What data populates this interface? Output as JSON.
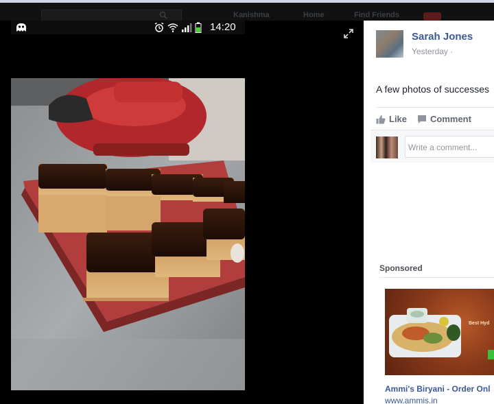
{
  "topbar": {
    "items": [
      "Kanishma",
      "Home",
      "Find Friends"
    ]
  },
  "status_bar": {
    "time": "14:20"
  },
  "post": {
    "author": "Sarah Jones",
    "timestamp": "Yesterday ·",
    "caption": "A few photos of successes",
    "actions": {
      "like_label": "Like",
      "comment_label": "Comment"
    },
    "comment_placeholder": "Write a comment..."
  },
  "sponsored": {
    "label": "Sponsored",
    "ad_title": "Ammi's Biryani - Order Onl",
    "ad_url": "www.ammis.in",
    "ad_image_text": "Best Hyd"
  },
  "colors": {
    "link": "#3b5998",
    "panel_bg": "#ffffff",
    "stage_bg": "#000000"
  }
}
